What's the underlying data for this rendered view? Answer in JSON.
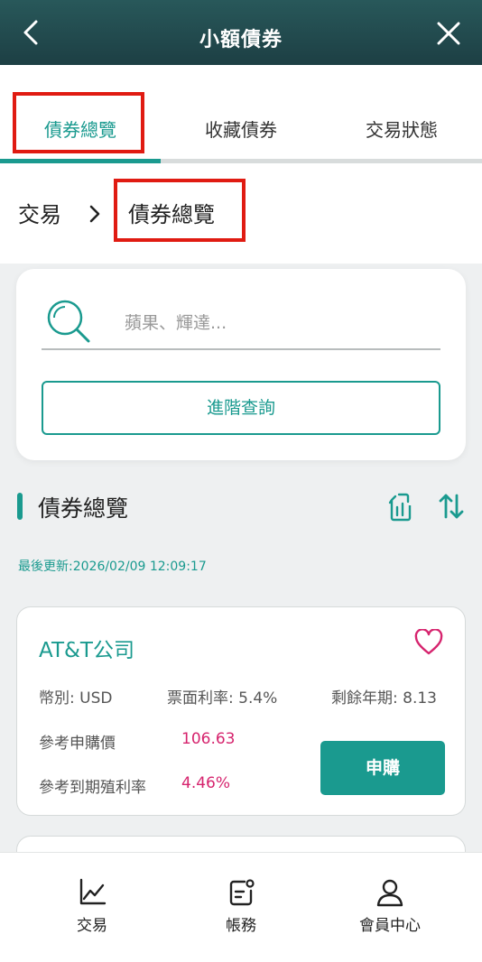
{
  "header": {
    "title": "小額債券",
    "back_icon": "chevron-left-icon",
    "close_icon": "close-icon"
  },
  "tabs": [
    {
      "label": "債券總覽",
      "active": true
    },
    {
      "label": "收藏債券",
      "active": false
    },
    {
      "label": "交易狀態",
      "active": false
    }
  ],
  "breadcrumb": {
    "parent": "交易",
    "current": "債券總覽"
  },
  "search": {
    "placeholder": "蘋果、輝達...",
    "value": "",
    "advanced_label": "進階查詢"
  },
  "section": {
    "title": "債券總覽",
    "updated": "最後更新:2026/02/09 12:09:17"
  },
  "bonds": [
    {
      "name": "AT&T公司",
      "currency": "幣別: USD",
      "coupon": "票面利率: 5.4%",
      "remaining": "剩餘年期: 8.13",
      "price_label": "參考申購價",
      "price": "106.63",
      "ytm_label": "參考到期殖利率",
      "ytm": "4.46%",
      "buy_label": "申購"
    }
  ],
  "bottom_nav": [
    {
      "label": "交易",
      "icon": "chart-line-icon"
    },
    {
      "label": "帳務",
      "icon": "document-icon"
    },
    {
      "label": "會員中心",
      "icon": "user-icon"
    }
  ],
  "colors": {
    "accent": "#1a9a8f",
    "header": "#1d3f44",
    "highlight": "#e01b12",
    "value": "#d6246e"
  }
}
